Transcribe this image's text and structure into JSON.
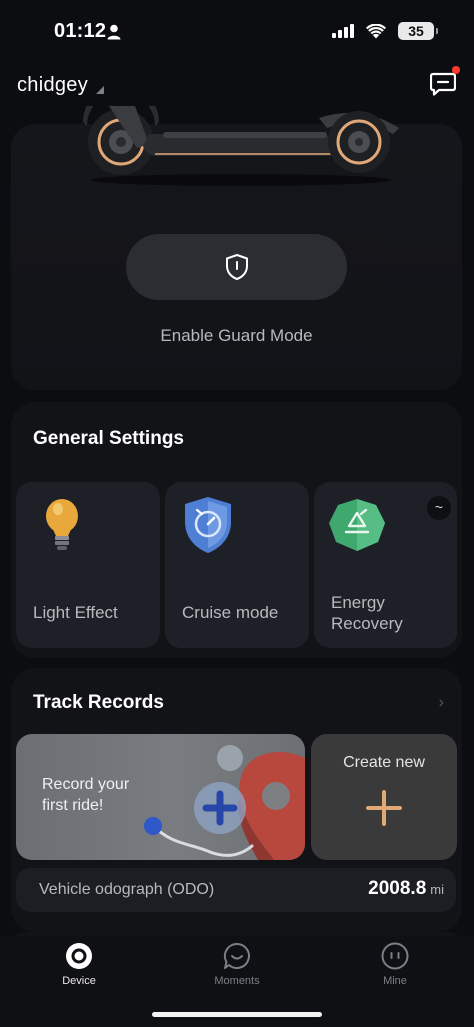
{
  "status_bar": {
    "time": "01:12",
    "battery": "35",
    "icons": [
      "person-icon",
      "cellular-signal-icon",
      "wifi-icon",
      "battery-icon"
    ]
  },
  "header": {
    "device_name": "chidgey",
    "icons": [
      "message-icon"
    ],
    "has_notification": true
  },
  "hero": {
    "guard_button_label": "Enable Guard Mode",
    "guard_icon": "shield-icon"
  },
  "general_settings": {
    "title": "General Settings",
    "tiles": [
      {
        "label": "Light Effect",
        "icon": "lightbulb-icon"
      },
      {
        "label": "Cruise mode",
        "icon": "cruise-shield-icon"
      },
      {
        "label_line1": "Energy",
        "label_line2": "Recovery",
        "icon": "recycle-icon",
        "badge": "~"
      }
    ]
  },
  "track_records": {
    "title": "Track Records",
    "record_line1": "Record your",
    "record_line2": "first ride!",
    "create_label": "Create new",
    "odo_label": "Vehicle odograph (ODO)",
    "odo_value": "2008.8",
    "odo_unit": "mi"
  },
  "bottom_nav": {
    "items": [
      {
        "label": "Device",
        "icon": "device-icon",
        "active": true
      },
      {
        "label": "Moments",
        "icon": "chat-bubble-icon",
        "active": false
      },
      {
        "label": "Mine",
        "icon": "face-icon",
        "active": false
      }
    ]
  },
  "colors": {
    "background": "#0c0d10",
    "card": "#121317",
    "tile": "#1e2027",
    "accent_orange": "#e0a878",
    "notification": "#ff3b30"
  }
}
